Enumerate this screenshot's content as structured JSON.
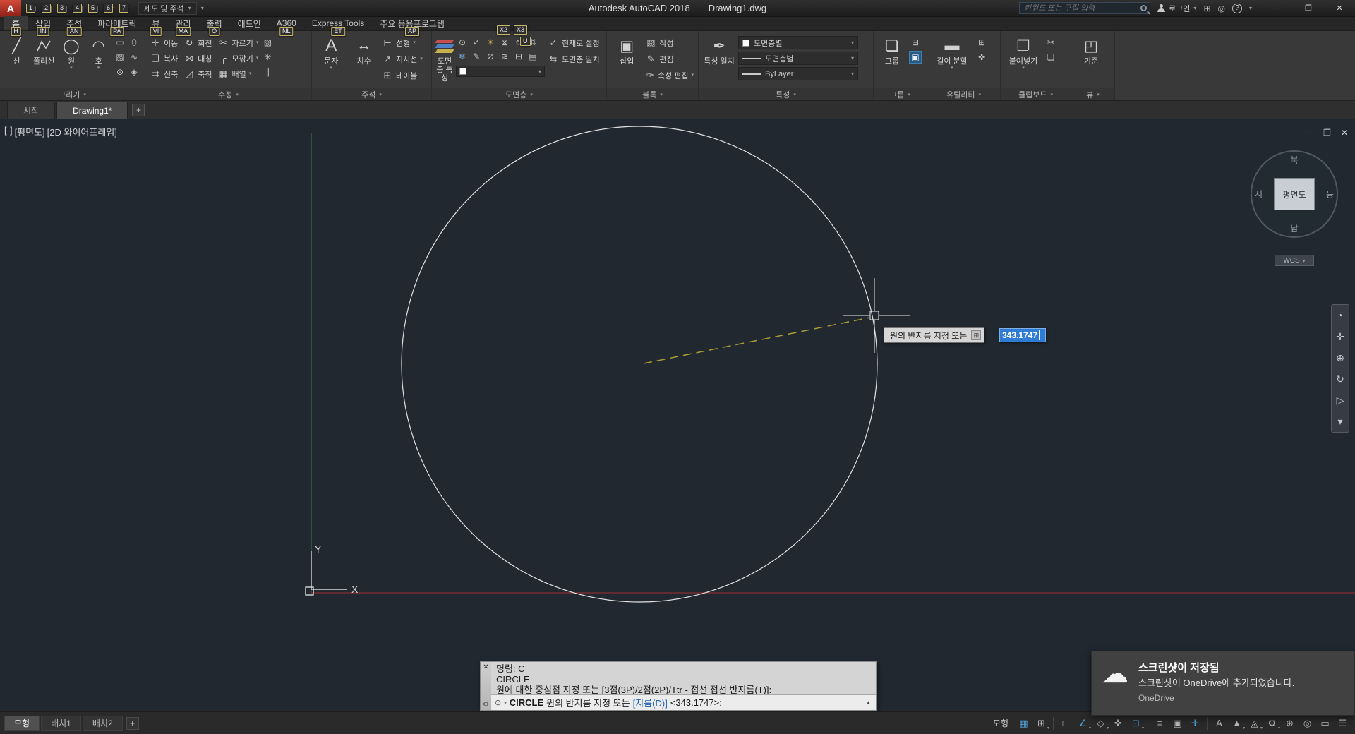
{
  "titlebar": {
    "workspace": "제도 및 주석",
    "app_title": "Autodesk AutoCAD 2018",
    "doc_title": "Drawing1.dwg",
    "search_placeholder": "키워드 또는 구절 입력",
    "signin": "로그인",
    "qat_keytips": [
      "1",
      "2",
      "3",
      "4",
      "5",
      "6",
      "7"
    ]
  },
  "keytips_floating": [
    "X2",
    "X3",
    "U"
  ],
  "ribbon": {
    "tabs": [
      {
        "label": "홈",
        "keytip": "H"
      },
      {
        "label": "삽입",
        "keytip": "IN"
      },
      {
        "label": "주석",
        "keytip": "AN"
      },
      {
        "label": "파라메트릭",
        "keytip": "PA"
      },
      {
        "label": "뷰",
        "keytip": "VI"
      },
      {
        "label": "관리",
        "keytip": "MA"
      },
      {
        "label": "출력",
        "keytip": "O"
      },
      {
        "label": "애드인",
        "keytip": ""
      },
      {
        "label": "A360",
        "keytip": "NL"
      },
      {
        "label": "Express Tools",
        "keytip": "ET"
      },
      {
        "label": "주요 응용프로그램",
        "keytip": "AP"
      }
    ],
    "draw": {
      "label": "그리기",
      "line": "선",
      "polyline": "폴리선",
      "circle": "원",
      "arc": "호"
    },
    "modify": {
      "label": "수정",
      "move": "이동",
      "rotate": "회전",
      "trim": "자르기",
      "copy": "복사",
      "mirror": "대칭",
      "fillet": "모깎기",
      "stretch": "신축",
      "scale": "축척",
      "array": "배열"
    },
    "annotation": {
      "label": "주석",
      "text": "문자",
      "dim": "치수",
      "linear": "선형",
      "leader": "지시선",
      "table": "테이블"
    },
    "layers": {
      "label": "도면층",
      "properties": "도면층 특성",
      "set_current": "현재로 설정",
      "match": "도면층 일치"
    },
    "block": {
      "label": "블록",
      "insert": "삽입",
      "create": "작성",
      "edit": "편집",
      "attrib": "속성 편집"
    },
    "props": {
      "label": "특성",
      "match": "특성 일치",
      "color": "도면층별",
      "lineweight": "도면층별",
      "linetype": "ByLayer"
    },
    "groups": {
      "label": "그룹",
      "group": "그룹"
    },
    "utilities": {
      "label": "유틸리티",
      "measure": "길이 분할"
    },
    "clipboard": {
      "label": "클립보드",
      "paste": "붙여넣기"
    },
    "view": {
      "label": "뷰",
      "base": "기준"
    }
  },
  "filetabs": {
    "start": "시작",
    "drawing": "Drawing1*"
  },
  "canvas": {
    "vp_controls": "[-]",
    "vp_view": "[평면도]",
    "vp_visual": "[2D 와이어프레임]",
    "viewcube": {
      "n": "북",
      "e": "동",
      "s": "남",
      "w": "서",
      "center": "평면도",
      "wcs": "WCS"
    },
    "ucs_x": "X",
    "ucs_y": "Y"
  },
  "dyninput": {
    "prompt": "원의 반지름 지정 또는",
    "value": "343.1747"
  },
  "cmd": {
    "line1": "명령: C",
    "line2": "CIRCLE",
    "line3": "원에 대한 중심점 지정 또는 [3점(3P)/2점(2P)/Ttr - 접선 접선 반지름(T)]:",
    "cmd_name": "CIRCLE",
    "prompt": "원의 반지름 지정 또는",
    "option": "[지름(D)]",
    "default": "<343.1747>:"
  },
  "layouts": {
    "model": "모형",
    "layout1": "배치1",
    "layout2": "배치2"
  },
  "statusbar": {
    "model": "모형",
    "icons": [
      {
        "name": "grid",
        "glyph": "▦",
        "active": true
      },
      {
        "name": "snap-mode",
        "glyph": "⊞"
      },
      {
        "name": "ortho",
        "glyph": "∟"
      },
      {
        "name": "polar-tracking",
        "glyph": "∠",
        "active": true
      },
      {
        "name": "isometric-drafting",
        "glyph": "◇"
      },
      {
        "name": "osnap-tracking",
        "glyph": "✜"
      },
      {
        "name": "object-snap",
        "glyph": "⊡",
        "active": true
      },
      {
        "name": "lineweight",
        "glyph": "≡"
      },
      {
        "name": "selection-cycling",
        "glyph": "▣"
      },
      {
        "name": "dynamic-input",
        "glyph": "✛",
        "active": true
      },
      {
        "name": "annotation-visibility",
        "glyph": "A"
      },
      {
        "name": "autoscale",
        "glyph": "▲"
      },
      {
        "name": "annotation-scale",
        "glyph": "◬"
      },
      {
        "name": "workspace-switching",
        "glyph": "⚙"
      },
      {
        "name": "annotation-monitor",
        "glyph": "⊕"
      },
      {
        "name": "isolate-objects",
        "glyph": "◎"
      },
      {
        "name": "clean-screen",
        "glyph": "▭"
      },
      {
        "name": "customization",
        "glyph": "☰"
      }
    ]
  },
  "toast": {
    "title": "스크린샷이 저장됨",
    "body": "스크린샷이 OneDrive에 추가되었습니다.",
    "source": "OneDrive"
  }
}
